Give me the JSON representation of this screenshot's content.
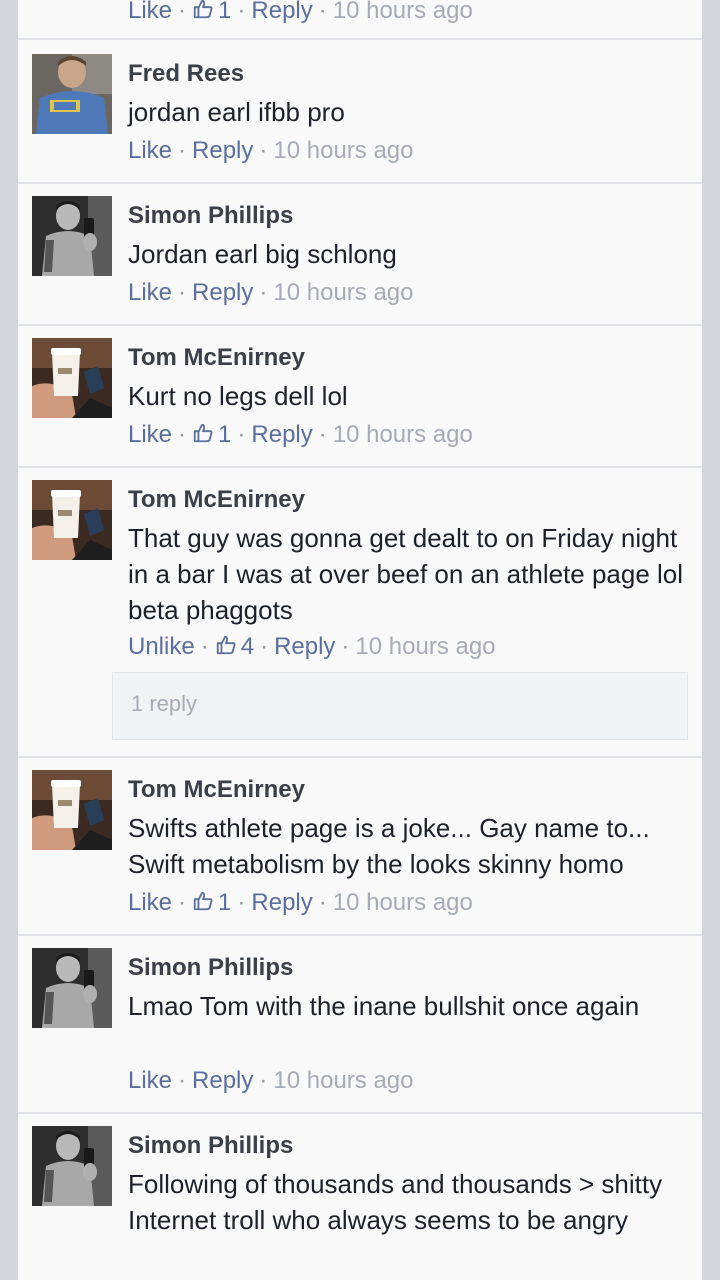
{
  "comments": [
    {
      "author": "",
      "text": "",
      "like_label": "Like",
      "likes": "1",
      "reply_label": "Reply",
      "time": "10 hours ago",
      "avatar": "partial-avatar"
    },
    {
      "author": "Fred Rees",
      "text": "jordan earl ifbb pro",
      "like_label": "Like",
      "likes": "",
      "reply_label": "Reply",
      "time": "10 hours ago",
      "avatar": "man-in-blue-shirt"
    },
    {
      "author": "Simon Phillips",
      "text": "Jordan earl big schlong",
      "like_label": "Like",
      "likes": "",
      "reply_label": "Reply",
      "time": "10 hours ago",
      "avatar": "shirtless-mirror-selfie"
    },
    {
      "author": "Tom McEnirney",
      "text": "Kurt no legs dell lol",
      "like_label": "Like",
      "likes": "1",
      "reply_label": "Reply",
      "time": "10 hours ago",
      "avatar": "hand-holding-coffee-cup"
    },
    {
      "author": "Tom McEnirney",
      "text": "That guy was gonna get dealt to on Friday night in a bar I was at over beef on an athlete page lol beta phaggots",
      "like_label": "Unlike",
      "likes": "4",
      "reply_label": "Reply",
      "time": "10 hours ago",
      "avatar": "hand-holding-coffee-cup",
      "replies_label": "1 reply"
    },
    {
      "author": "Tom McEnirney",
      "text": "Swifts athlete page is a joke... Gay name to... Swift metabolism by the looks skinny homo",
      "like_label": "Like",
      "likes": "1",
      "reply_label": "Reply",
      "time": "10 hours ago",
      "avatar": "hand-holding-coffee-cup"
    },
    {
      "author": "Simon Phillips",
      "text": "Lmao Tom with the inane bullshit once again",
      "like_label": "Like",
      "likes": "",
      "reply_label": "Reply",
      "time": "10 hours ago",
      "avatar": "shirtless-mirror-selfie"
    },
    {
      "author": "Simon Phillips",
      "text": "Following of thousands and thousands > shitty Internet troll who always seems to be angry",
      "like_label": "",
      "likes": "",
      "reply_label": "",
      "time": "",
      "avatar": "shirtless-mirror-selfie"
    }
  ],
  "colors": {
    "link": "#5b6f9e",
    "meta": "#a6abb5",
    "name": "#3b3f47",
    "body": "#1d2129",
    "background": "#f9f9f9",
    "frame": "#d3d6db"
  }
}
